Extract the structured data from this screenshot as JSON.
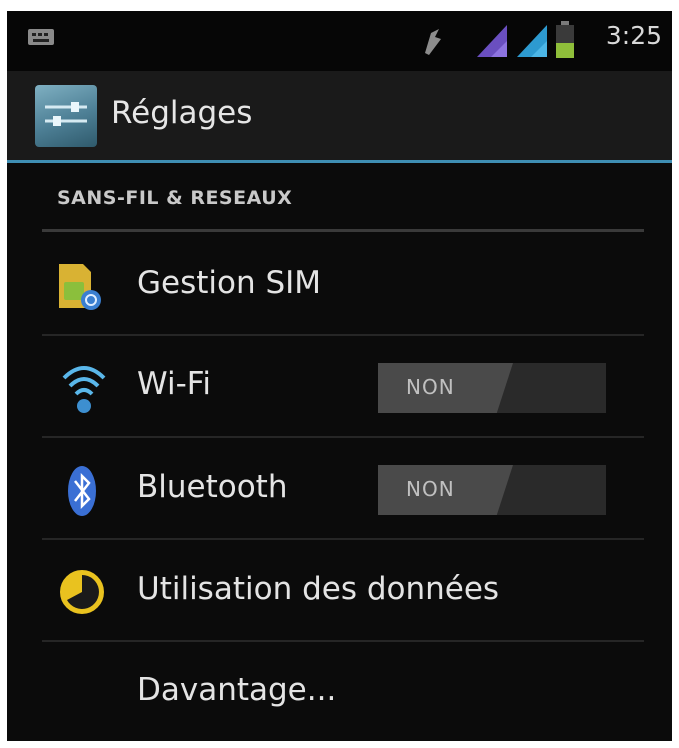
{
  "status_bar": {
    "time": "3:25",
    "icons": [
      "notification-icon",
      "gps-icon",
      "signal-icon",
      "signal-icon",
      "battery-icon"
    ]
  },
  "action_bar": {
    "title": "Réglages",
    "icon": "settings-app-icon"
  },
  "section": {
    "header": "SANS-FIL & RESEAUX"
  },
  "items": [
    {
      "label": "Gestion SIM",
      "icon": "sim-card-icon"
    },
    {
      "label": "Wi-Fi",
      "icon": "wifi-icon",
      "toggle": "NON"
    },
    {
      "label": "Bluetooth",
      "icon": "bluetooth-icon",
      "toggle": "NON"
    },
    {
      "label": "Utilisation des données",
      "icon": "data-usage-icon"
    },
    {
      "label": "Davantage..."
    }
  ],
  "colors": {
    "accent": "#3f8fb4",
    "background": "#0b0b0b",
    "text": "#e4e4e4"
  }
}
